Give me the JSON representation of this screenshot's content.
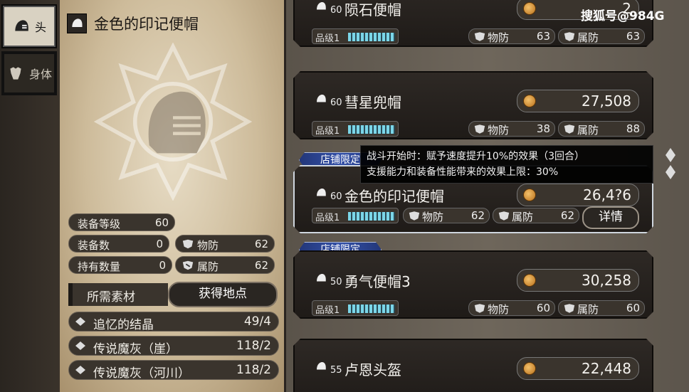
{
  "categories": [
    {
      "label": "头",
      "icon": "helmet-icon",
      "active": true
    },
    {
      "label": "身体",
      "icon": "armor-icon",
      "active": false
    }
  ],
  "detail": {
    "title": "金色的印记便帽",
    "stats": {
      "equip_level": {
        "label": "装备等级",
        "value": "60"
      },
      "equip_count": {
        "label": "装备数",
        "value": "0"
      },
      "owned": {
        "label": "持有数量",
        "value": "0"
      },
      "phys_def": {
        "label": "物防",
        "value": "62"
      },
      "elem_def": {
        "label": "属防",
        "value": "62"
      }
    },
    "materials_label": "所需素材",
    "obtain_button": "获得地点",
    "materials": [
      {
        "name": "追忆的结晶",
        "qty": "49/4"
      },
      {
        "name": "传说魔灰（崖）",
        "qty": "118/2"
      },
      {
        "name": "传说魔灰（河川）",
        "qty": "118/2"
      }
    ]
  },
  "list": {
    "grade_label": "品级",
    "phys_label": "物防",
    "elem_label": "属防",
    "shop_badge": "店铺限定",
    "detail_button": "详情",
    "items": [
      {
        "level": "60",
        "name": "陨石便帽",
        "price": "2",
        "grade": "1",
        "phys": "63",
        "elem": "63"
      },
      {
        "level": "60",
        "name": "彗星兜帽",
        "price": "27,508",
        "grade": "1",
        "phys": "38",
        "elem": "88"
      },
      {
        "level": "60",
        "name": "金色的印记便帽",
        "price": "26,4?6",
        "grade": "1",
        "phys": "62",
        "elem": "62"
      },
      {
        "level": "50",
        "name": "勇气便帽3",
        "price": "30,258",
        "grade": "1",
        "phys": "60",
        "elem": "60"
      },
      {
        "level": "55",
        "name": "卢恩头盔",
        "price": "22,448",
        "grade": "",
        "phys": "",
        "elem": ""
      }
    ]
  },
  "tooltip": {
    "line1": "战斗开始时：赋予速度提升10%的效果（3回合）",
    "line2": "支援能力和装备性能带来的效果上限：30%"
  },
  "watermark": "搜狐号@984G",
  "colors": {
    "accent_blue": "#3350a8",
    "grade_bar": "#7bd6e8",
    "coin": "#d9962e"
  }
}
